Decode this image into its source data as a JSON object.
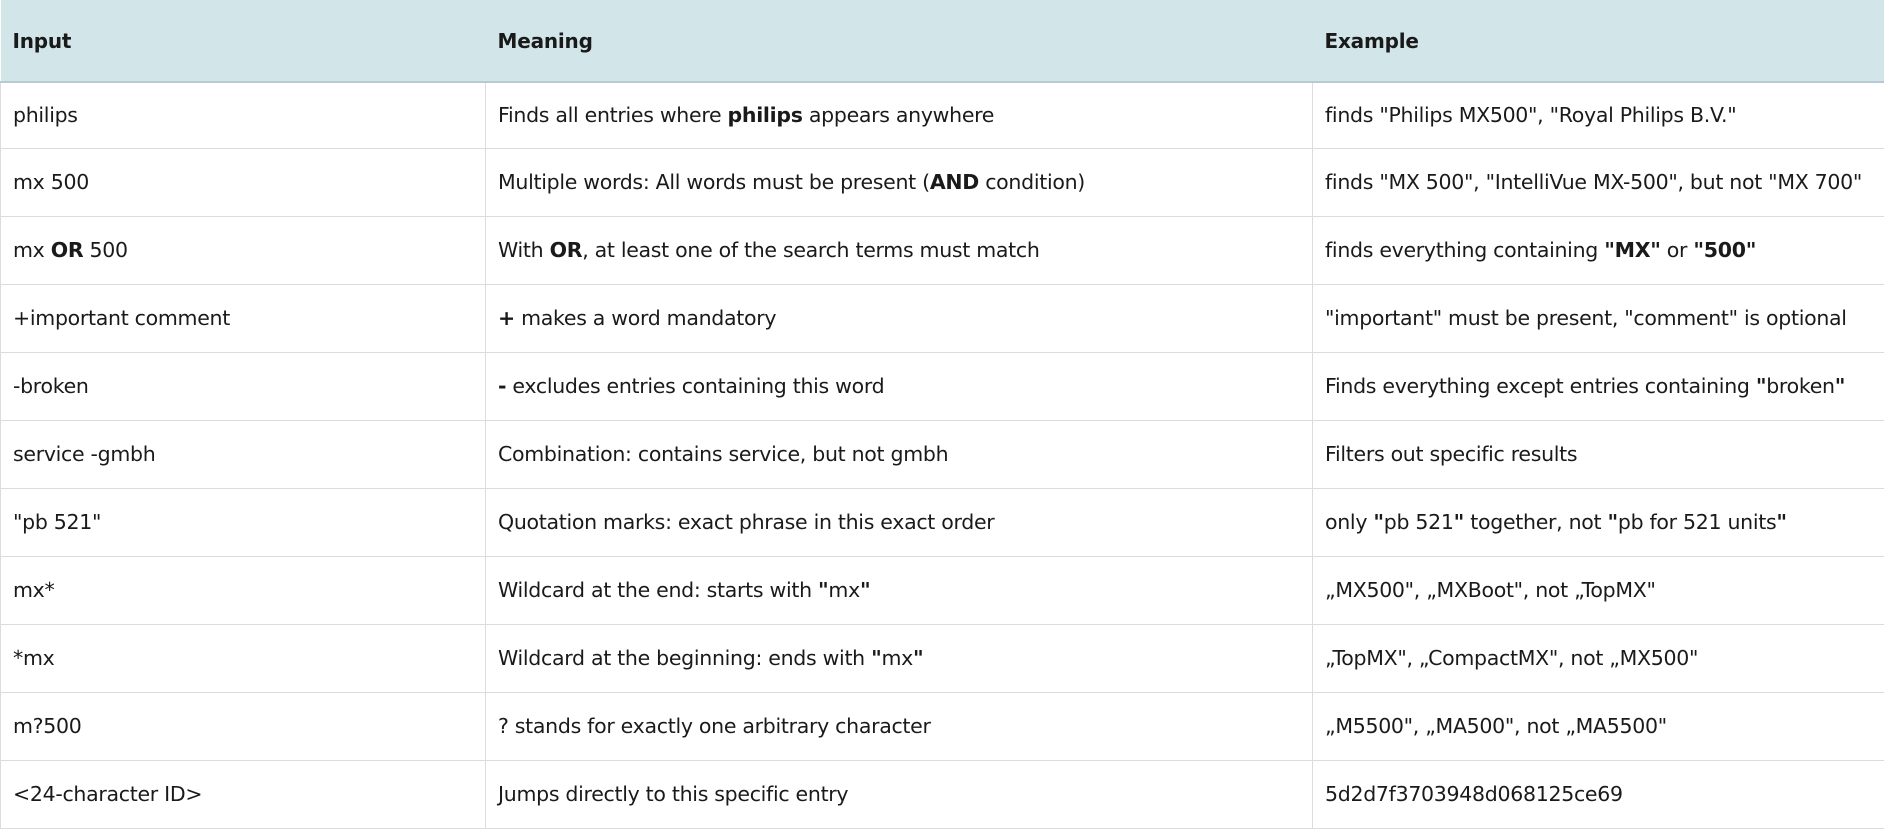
{
  "table": {
    "headers": {
      "input": "Input",
      "meaning": "Meaning",
      "example": "Example"
    },
    "rows": [
      {
        "input": {
          "a": "philips"
        },
        "meaning": {
          "a": "Finds all entries where ",
          "b": "philips",
          "c": " appears anywhere"
        },
        "example": {
          "a": "finds \"Philips MX500\", \"Royal Philips B.V.\""
        }
      },
      {
        "input": {
          "a": "mx 500"
        },
        "meaning": {
          "a": "Multiple words: All words must be present (",
          "b": "AND",
          "c": " condition)"
        },
        "example": {
          "a": "finds \"MX 500\", \"IntelliVue MX-500\", but not \"MX 700\""
        }
      },
      {
        "input": {
          "a": "mx ",
          "b": "OR",
          "c": " 500"
        },
        "meaning": {
          "a": "With ",
          "b": "OR",
          "c": ", at least one of the search terms must match"
        },
        "example": {
          "a": "finds everything containing ",
          "b": "\"",
          "c": "MX",
          "d": "\"",
          "e": " or ",
          "f": "\"",
          "g": "500",
          "h": "\""
        }
      },
      {
        "input": {
          "a": "+important comment"
        },
        "meaning": {
          "b": "+",
          "c": " makes a word mandatory"
        },
        "example": {
          "a": "\"important\" must be present, \"comment\" is optional"
        }
      },
      {
        "input": {
          "a": "-broken"
        },
        "meaning": {
          "b": "-",
          "c": " excludes entries containing this word"
        },
        "example": {
          "a": "Finds everything except entries containing ",
          "b": "\"",
          "c": "broken",
          "d": "\""
        }
      },
      {
        "input": {
          "a": "service -gmbh"
        },
        "meaning": {
          "a": "Combination: contains service, but not gmbh"
        },
        "example": {
          "a": "Filters out specific results"
        }
      },
      {
        "input": {
          "a": "\"pb 521\""
        },
        "meaning": {
          "a": "Quotation marks: exact phrase in this exact order"
        },
        "example": {
          "a": "only ",
          "b": "\"",
          "c": "pb 521",
          "d": "\"",
          "e": " together, not ",
          "f": "\"",
          "g": "pb for 521 units",
          "h": "\""
        }
      },
      {
        "input": {
          "a": "mx*"
        },
        "meaning": {
          "a": "Wildcard at the end: starts with ",
          "b": "\"",
          "c": "mx",
          "d": "\""
        },
        "example": {
          "a": "„MX500\", „MXBoot\", not „TopMX\""
        }
      },
      {
        "input": {
          "a": "*mx"
        },
        "meaning": {
          "a": "Wildcard at the beginning: ends with ",
          "b": "\"",
          "c": "mx",
          "d": "\""
        },
        "example": {
          "a": "„TopMX\", „CompactMX\", not „MX500\""
        }
      },
      {
        "input": {
          "a": "m?500"
        },
        "meaning": {
          "a": "? stands for exactly one arbitrary character"
        },
        "example": {
          "a": "„M5500\", „MA500\", not „MA5500\""
        }
      },
      {
        "input": {
          "a": "<24-character ID>"
        },
        "meaning": {
          "a": "Jumps directly to this specific entry"
        },
        "example": {
          "a": "5d2d7f3703948d068125ce69"
        }
      }
    ]
  }
}
